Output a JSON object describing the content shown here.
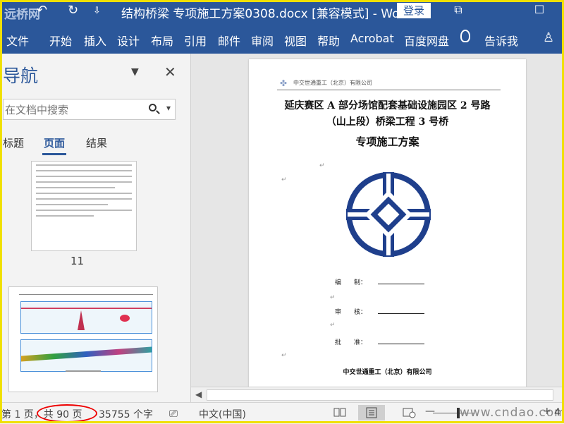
{
  "watermark_top": "远桥网",
  "title_bar": {
    "title": "结构桥梁 专项施工方案0308.docx [兼容模式] - Word",
    "login_label": "登录",
    "undo_glyph": "↶",
    "redo_glyph": "↻",
    "customize_glyph": "⇩",
    "restore_glyph": "⧉",
    "maximize_glyph": "☐"
  },
  "ribbon": {
    "tabs": [
      "文件",
      "开始",
      "插入",
      "设计",
      "布局",
      "引用",
      "邮件",
      "审阅",
      "视图",
      "帮助",
      "Acrobat",
      "百度网盘"
    ],
    "tell_me": "告诉我",
    "share_glyph": "♙"
  },
  "nav_pane": {
    "heading": "导航",
    "search_placeholder": "在文档中搜索",
    "tabs": [
      "标题",
      "页面",
      "结果"
    ],
    "active_tab": "页面",
    "page_label_1": "11"
  },
  "document": {
    "header_text": "中交世通重工（北京）有限公司",
    "title_line1": "延庆赛区 A 部分场馆配套基础设施园区 2 号路",
    "title_line2": "（山上段）桥梁工程 3 号桥",
    "subtitle": "专项施工方案",
    "paragraph_mark": "↵",
    "sig_compile": "编　　制：",
    "sig_review": "审　　核：",
    "sig_approve": "批　　准：",
    "company": "中交世通重工（北京）有限公司"
  },
  "status_bar": {
    "page_info": "第 1 页，共 90 页",
    "word_count": "35755 个字",
    "language": "中文(中国)",
    "zoom_minus": "—",
    "zoom_plus": "+",
    "zoom_value": "4",
    "watermark": "www.cndao.com"
  },
  "colors": {
    "word_blue": "#2b579a",
    "highlight_circle": "#ee0000",
    "frame_yellow": "#f0e000",
    "logo_blue": "#1f3f8c"
  }
}
